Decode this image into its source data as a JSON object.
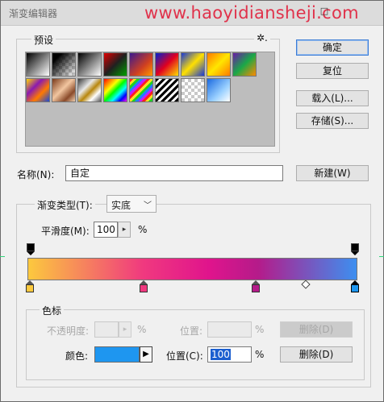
{
  "window": {
    "title": "渐变编辑器",
    "watermark": "www.haoyidiansheji.com",
    "close_glyph": "□"
  },
  "presets": {
    "label": "预设",
    "menu_icon": "gear-icon",
    "menu_glyph": "✲.",
    "swatches": [
      {
        "name": "foreground-to-background"
      },
      {
        "name": "foreground-to-transparent"
      },
      {
        "name": "black-to-white"
      },
      {
        "name": "red-green"
      },
      {
        "name": "violet-orange"
      },
      {
        "name": "blue-red-yellow"
      },
      {
        "name": "blue-yellow-blue"
      },
      {
        "name": "orange-yellow-orange"
      },
      {
        "name": "violet-green-orange"
      },
      {
        "name": "yellow-violet-orange-blue"
      },
      {
        "name": "copper"
      },
      {
        "name": "chrome"
      },
      {
        "name": "spectrum"
      },
      {
        "name": "transparent-rainbow"
      },
      {
        "name": "transparent-stripes"
      },
      {
        "name": "transparent-checker"
      },
      {
        "name": "sky-blue"
      }
    ]
  },
  "buttons": {
    "ok": "确定",
    "reset": "复位",
    "load": "载入(L)...",
    "save": "存储(S)...",
    "new": "新建(W)"
  },
  "name": {
    "label": "名称(N):",
    "value": "自定"
  },
  "gradient": {
    "type_label": "渐变类型(T):",
    "type_value": "实底",
    "smoothness_label": "平滑度(M):",
    "smoothness_value": "100",
    "smoothness_unit": "%",
    "colors": [
      "#fcc93e",
      "#f0397f",
      "#e0148c",
      "#b51b8a",
      "#3d8ff0"
    ]
  },
  "stops": {
    "group_label": "色标",
    "opacity_label": "不透明度:",
    "opacity_value": "",
    "opacity_unit": "%",
    "opacity_location_label": "位置:",
    "opacity_location_value": "",
    "opacity_location_unit": "%",
    "opacity_delete": "删除(D)",
    "color_label": "颜色:",
    "color_value": "#1e96f0",
    "color_location_label": "位置(C):",
    "color_location_value": "100",
    "color_location_unit": "%",
    "color_delete": "删除(D)"
  }
}
